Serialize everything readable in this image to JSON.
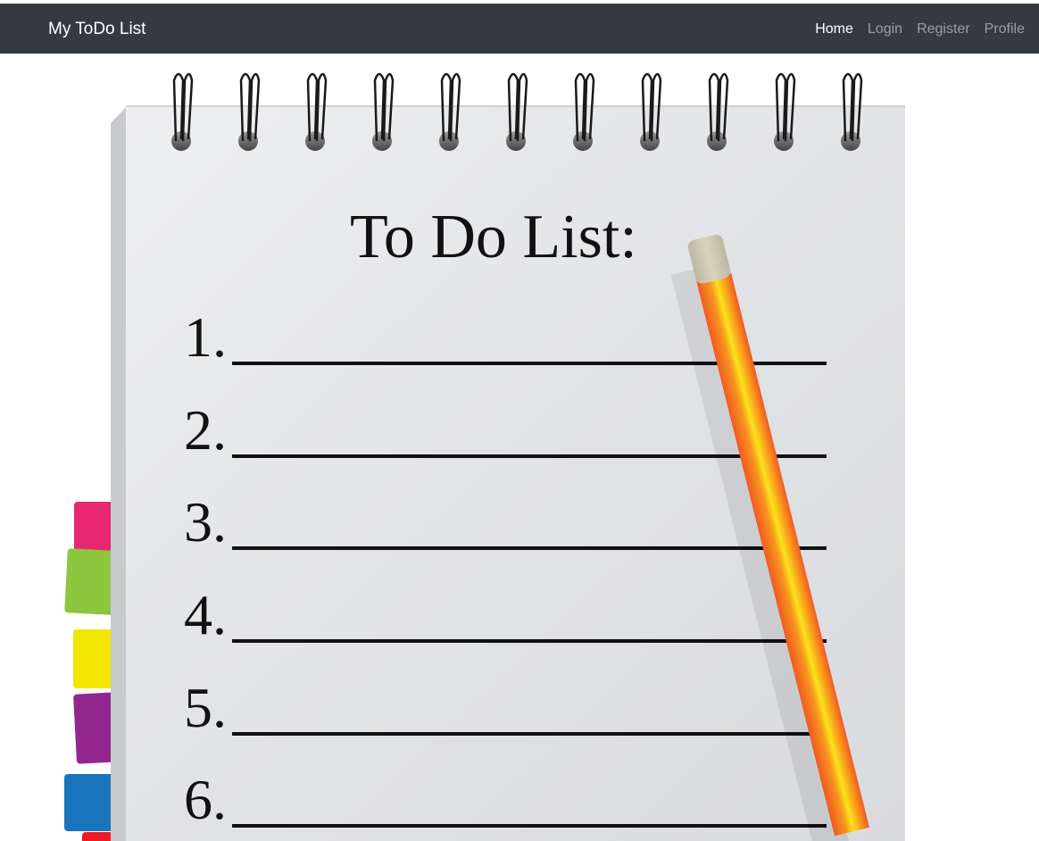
{
  "navbar": {
    "brand": "My ToDo List",
    "links": [
      {
        "label": "Home",
        "active": true
      },
      {
        "label": "Login",
        "active": false
      },
      {
        "label": "Register",
        "active": false
      },
      {
        "label": "Profile",
        "active": false
      }
    ],
    "background_color": "#343a40"
  },
  "hero_image": {
    "title": "To Do List:",
    "items": [
      "1.",
      "2.",
      "3.",
      "4.",
      "5.",
      "6."
    ],
    "tab_colors": [
      "#e8286e",
      "#8dc63f",
      "#f2e600",
      "#92278f",
      "#1b75bc",
      "#ed1c24"
    ],
    "pencil_color": "#f7941d",
    "paper_color": "#e1e2e5"
  }
}
